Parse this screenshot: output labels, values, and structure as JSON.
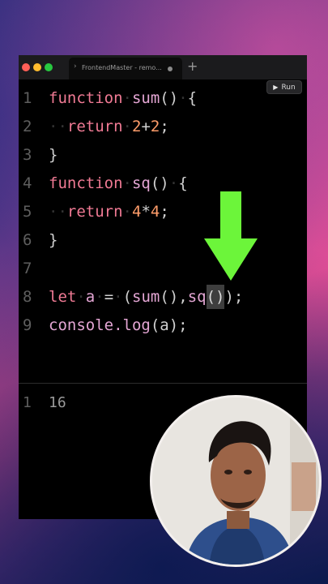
{
  "window": {
    "traffic_lights": [
      "#ff5f57",
      "#febc2e",
      "#28c840"
    ],
    "tab_title": "FrontendMaster - remo...",
    "new_tab_label": "+",
    "run_button": {
      "icon": "play-icon",
      "label": "Run"
    }
  },
  "editor": {
    "lines": [
      {
        "num": "1",
        "tokens": [
          {
            "t": "function",
            "c": "kw"
          },
          {
            "t": "·",
            "c": "ws"
          },
          {
            "t": "sum",
            "c": "fn"
          },
          {
            "t": "()",
            "c": "pn"
          },
          {
            "t": "·",
            "c": "ws"
          },
          {
            "t": "{",
            "c": "pn"
          }
        ]
      },
      {
        "num": "2",
        "tokens": [
          {
            "t": "··",
            "c": "ws"
          },
          {
            "t": "return",
            "c": "kw"
          },
          {
            "t": "·",
            "c": "ws"
          },
          {
            "t": "2",
            "c": "num"
          },
          {
            "t": "+",
            "c": "pn"
          },
          {
            "t": "2",
            "c": "num"
          },
          {
            "t": ";",
            "c": "pn"
          }
        ]
      },
      {
        "num": "3",
        "tokens": [
          {
            "t": "}",
            "c": "pn"
          }
        ]
      },
      {
        "num": "4",
        "tokens": [
          {
            "t": "function",
            "c": "kw"
          },
          {
            "t": "·",
            "c": "ws"
          },
          {
            "t": "sq",
            "c": "fn"
          },
          {
            "t": "()",
            "c": "pn"
          },
          {
            "t": "·",
            "c": "ws"
          },
          {
            "t": "{",
            "c": "pn"
          }
        ]
      },
      {
        "num": "5",
        "tokens": [
          {
            "t": "··",
            "c": "ws"
          },
          {
            "t": "return",
            "c": "kw"
          },
          {
            "t": "·",
            "c": "ws"
          },
          {
            "t": "4",
            "c": "num"
          },
          {
            "t": "*",
            "c": "pn"
          },
          {
            "t": "4",
            "c": "num"
          },
          {
            "t": ";",
            "c": "pn"
          }
        ]
      },
      {
        "num": "6",
        "tokens": [
          {
            "t": "}",
            "c": "pn"
          }
        ]
      },
      {
        "num": "7",
        "tokens": []
      },
      {
        "num": "8",
        "tokens": [
          {
            "t": "let",
            "c": "kw"
          },
          {
            "t": "·",
            "c": "ws"
          },
          {
            "t": "a",
            "c": "fn"
          },
          {
            "t": "·",
            "c": "ws"
          },
          {
            "t": "=",
            "c": "pn"
          },
          {
            "t": "·",
            "c": "ws"
          },
          {
            "t": "(",
            "c": "pn"
          },
          {
            "t": "sum",
            "c": "fn"
          },
          {
            "t": "(),",
            "c": "pn"
          },
          {
            "t": "sq",
            "c": "fn"
          },
          {
            "t": "()",
            "c": "cursor"
          },
          {
            "t": ");",
            "c": "pn"
          }
        ]
      },
      {
        "num": "9",
        "tokens": [
          {
            "t": "console.log",
            "c": "fn"
          },
          {
            "t": "(a);",
            "c": "pn"
          }
        ]
      }
    ]
  },
  "output": {
    "line_number": "1",
    "value": "16"
  },
  "annotation": {
    "arrow_color": "#6cf53a",
    "icon": "down-arrow-icon"
  },
  "webcam": {
    "icon": "presenter-video"
  }
}
